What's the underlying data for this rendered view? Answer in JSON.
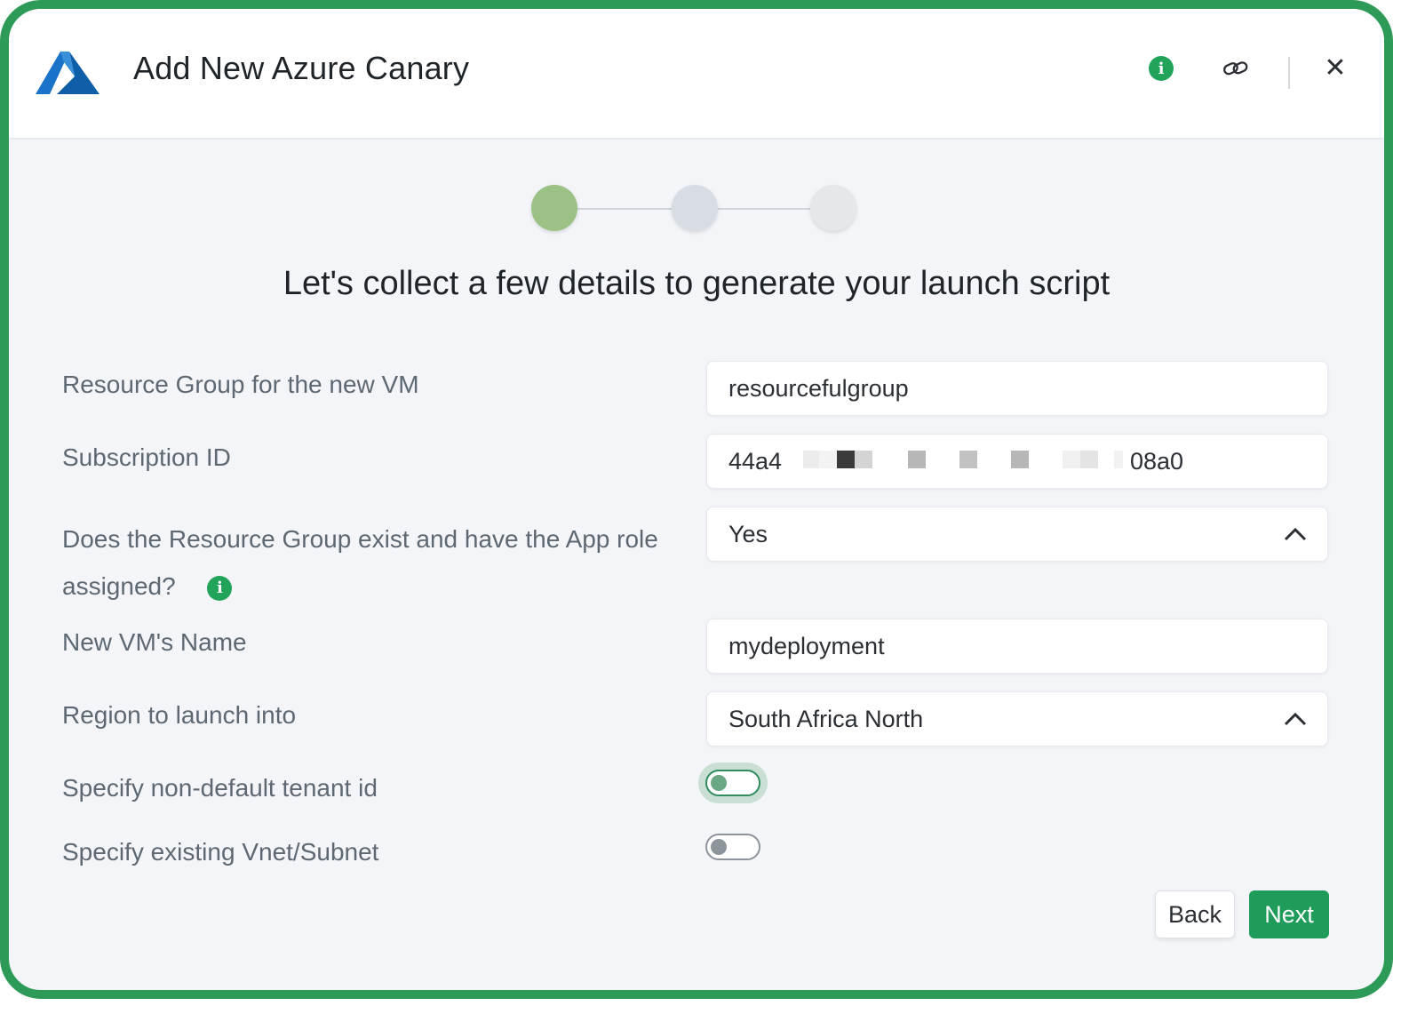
{
  "dialog": {
    "title": "Add New Azure Canary",
    "header_icons": [
      "info-icon",
      "link-icon",
      "close-icon"
    ],
    "close_glyph": "✕",
    "info_glyph": "i"
  },
  "stepper": {
    "steps": 3,
    "current": 1
  },
  "heading": "Let's collect a few details to generate your launch script",
  "form": {
    "resource_group": {
      "label": "Resource Group for the new VM",
      "value": "resourcefulgroup"
    },
    "subscription_id": {
      "label": "Subscription ID",
      "value_start": "44a4",
      "value_end": "08a0"
    },
    "group_exists": {
      "label": "Does the Resource Group exist and have the App role assigned?",
      "value": "Yes"
    },
    "vm_name": {
      "label": "New VM's Name",
      "value": "mydeployment"
    },
    "region": {
      "label": "Region to launch into",
      "value": "South Africa North"
    },
    "tenant_toggle": {
      "label": "Specify non-default tenant id",
      "on": false
    },
    "vnet_toggle": {
      "label": "Specify existing Vnet/Subnet",
      "on": false
    }
  },
  "buttons": {
    "back": "Back",
    "next": "Next"
  },
  "colors": {
    "accent": "#1f9c5a",
    "frame": "#2e9a57",
    "step_done": "#9cc184"
  }
}
